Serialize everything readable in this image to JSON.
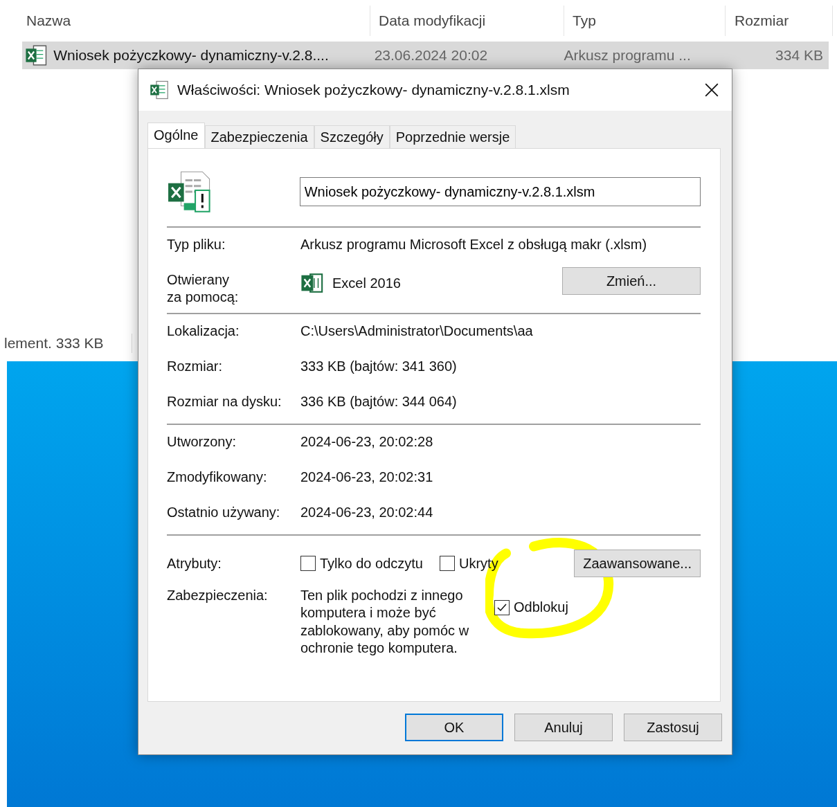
{
  "explorer": {
    "columns": [
      "Nazwa",
      "Data modyfikacji",
      "Typ",
      "Rozmiar"
    ],
    "file": {
      "selected": true,
      "cells": [
        "Wniosek pożyczkowy- dynamiczny-v.2.8....",
        "23.06.2024 20:02",
        "Arkusz programu ...",
        "334 KB"
      ]
    },
    "status_bar": "lement. 333 KB"
  },
  "dialog": {
    "title": "Właściwości: Wniosek pożyczkowy- dynamiczny-v.2.8.1.xlsm",
    "tabs": [
      {
        "label": "Ogólne",
        "selected": true
      },
      {
        "label": "Zabezpieczenia",
        "selected": false
      },
      {
        "label": "Szczegóły",
        "selected": false
      },
      {
        "label": "Poprzednie wersje",
        "selected": false
      }
    ],
    "file_name": "Wniosek pożyczkowy- dynamiczny-v.2.8.1.xlsm",
    "groups": [
      [
        {
          "kind": "text",
          "label": "Typ pliku:",
          "value": "Arkusz programu Microsoft Excel z obsługą makr (.xlsm)"
        },
        {
          "kind": "app",
          "label": "Otwierany\nza pomocą:",
          "value": "Excel 2016",
          "button": "Zmień..."
        }
      ],
      [
        {
          "kind": "text",
          "label": "Lokalizacja:",
          "value": "C:\\Users\\Administrator\\Documents\\aa"
        },
        {
          "kind": "text",
          "label": "Rozmiar:",
          "value": "333 KB (bajtów: 341 360)"
        },
        {
          "kind": "text",
          "label": "Rozmiar na dysku:",
          "value": "336 KB (bajtów: 344 064)"
        }
      ],
      [
        {
          "kind": "text",
          "label": "Utworzony:",
          "value": "2024-06-23, 20:02:28"
        },
        {
          "kind": "text",
          "label": "Zmodyfikowany:",
          "value": "2024-06-23, 20:02:31"
        },
        {
          "kind": "text",
          "label": "Ostatnio używany:",
          "value": "2024-06-23, 20:02:44"
        }
      ]
    ],
    "attributes": {
      "label": "Atrybuty:",
      "checkboxes": [
        {
          "label": "Tylko do odczytu",
          "checked": false
        },
        {
          "label": "Ukryty",
          "checked": false
        }
      ],
      "button": "Zaawansowane..."
    },
    "security": {
      "label": "Zabezpieczenia:",
      "text": "Ten plik pochodzi z innego komputera i może być zablokowany, aby pomóc w ochronie tego komputera.",
      "unblock": {
        "label": "Odblokuj",
        "checked": true
      }
    },
    "buttons": [
      {
        "label": "OK",
        "default": true
      },
      {
        "label": "Anuluj",
        "default": false
      },
      {
        "label": "Zastosuj",
        "default": false
      }
    ]
  }
}
